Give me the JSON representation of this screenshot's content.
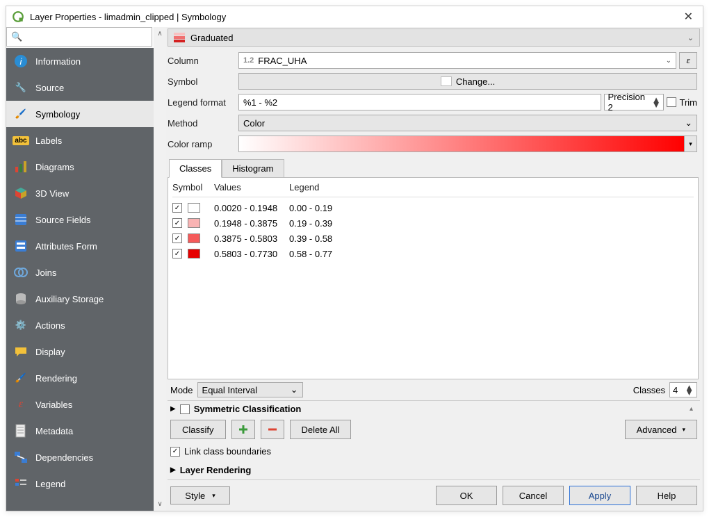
{
  "window": {
    "title": "Layer Properties - limadmin_clipped | Symbology"
  },
  "search": {
    "placeholder": ""
  },
  "sidebar": {
    "items": [
      {
        "label": "Information",
        "icon": "info"
      },
      {
        "label": "Source",
        "icon": "wrench"
      },
      {
        "label": "Symbology",
        "icon": "brush",
        "active": true
      },
      {
        "label": "Labels",
        "icon": "abc"
      },
      {
        "label": "Diagrams",
        "icon": "diagram"
      },
      {
        "label": "3D View",
        "icon": "cube"
      },
      {
        "label": "Source Fields",
        "icon": "fields"
      },
      {
        "label": "Attributes Form",
        "icon": "form"
      },
      {
        "label": "Joins",
        "icon": "join"
      },
      {
        "label": "Auxiliary Storage",
        "icon": "db"
      },
      {
        "label": "Actions",
        "icon": "gear"
      },
      {
        "label": "Display",
        "icon": "speech"
      },
      {
        "label": "Rendering",
        "icon": "brush2"
      },
      {
        "label": "Variables",
        "icon": "eps"
      },
      {
        "label": "Metadata",
        "icon": "doc"
      },
      {
        "label": "Dependencies",
        "icon": "deps"
      },
      {
        "label": "Legend",
        "icon": "legend"
      }
    ]
  },
  "renderer": {
    "label": "Graduated"
  },
  "form": {
    "column_label": "Column",
    "column_prefix": "1.2",
    "column_value": "FRAC_UHA",
    "epsilon_label": "ε",
    "symbol_label": "Symbol",
    "change_label": "Change...",
    "legend_format_label": "Legend format",
    "legend_format_value": "%1 - %2",
    "precision_label": "Precision 2",
    "trim_label": "Trim",
    "method_label": "Method",
    "method_value": "Color",
    "color_ramp_label": "Color ramp"
  },
  "tabs": {
    "classes": "Classes",
    "histogram": "Histogram"
  },
  "table": {
    "headers": {
      "symbol": "Symbol",
      "values": "Values",
      "legend": "Legend"
    },
    "rows": [
      {
        "color": "#ffffff",
        "values": "0.0020 - 0.1948",
        "legend": "0.00 - 0.19"
      },
      {
        "color": "#f9b3b3",
        "values": "0.1948 - 0.3875",
        "legend": "0.19 - 0.39"
      },
      {
        "color": "#f55a5a",
        "values": "0.3875 - 0.5803",
        "legend": "0.39 - 0.58"
      },
      {
        "color": "#e60000",
        "values": "0.5803 - 0.7730",
        "legend": "0.58 - 0.77"
      }
    ]
  },
  "mode": {
    "label": "Mode",
    "value": "Equal Interval",
    "classes_label": "Classes",
    "classes_value": "4"
  },
  "symclass": {
    "label": "Symmetric Classification"
  },
  "buttons": {
    "classify": "Classify",
    "delete_all": "Delete All",
    "advanced": "Advanced"
  },
  "link": {
    "label": "Link class boundaries",
    "checked": true
  },
  "layer_rendering": {
    "label": "Layer Rendering"
  },
  "footer": {
    "style": "Style",
    "ok": "OK",
    "cancel": "Cancel",
    "apply": "Apply",
    "help": "Help"
  }
}
